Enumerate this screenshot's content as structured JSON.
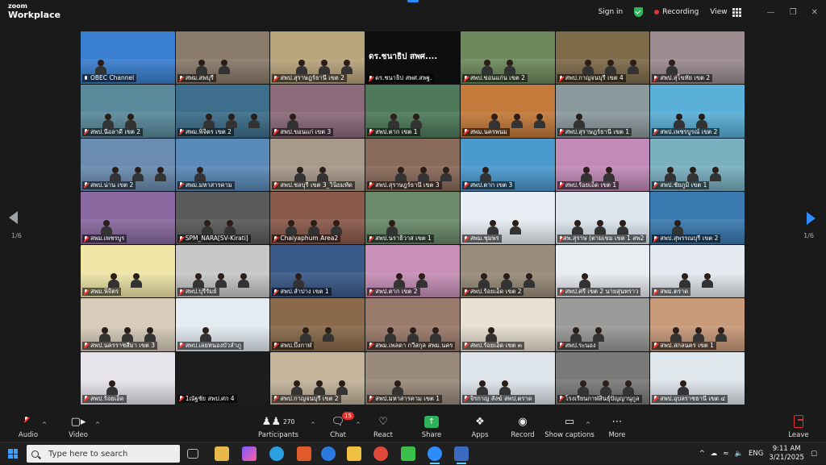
{
  "app": {
    "logo_line1": "zoom",
    "logo_line2": "Workplace"
  },
  "header": {
    "signin": "Sign in",
    "recording": "Recording",
    "view": "View",
    "accent": "#2d8cff",
    "recording_color": "#e0322e",
    "secure_color": "#2fb35a"
  },
  "pagination": {
    "left": "1/6",
    "right": "1/6"
  },
  "tiles": [
    {
      "name": "OBEC Channel",
      "muted": false,
      "bg": "#3a7fd0",
      "active": true
    },
    {
      "name": "สพม.สพบุรี",
      "muted": true,
      "bg": "#8a7a6a"
    },
    {
      "name": "สพป.สุราษฎร์ธานี เขต 2",
      "muted": true,
      "bg": "#b9a57c"
    },
    {
      "name": "ดร.ชนาธิป สพศ.สพฐ.",
      "muted": true,
      "bg": "#0e0e0e",
      "caption": "ดร.ชนาธิป สพศ...."
    },
    {
      "name": "สพป.ขอนแก่น เขต 2",
      "muted": true,
      "bg": "#6e8a5c"
    },
    {
      "name": "สพป.กาญจนบุรี เขต 4",
      "muted": true,
      "bg": "#7e6b4a"
    },
    {
      "name": "สพป.สุโขทัย เขต 2",
      "muted": true,
      "bg": "#9c8c90"
    },
    {
      "name": "สพป.นีอลาดี เขต 2",
      "muted": true,
      "bg": "#5a8a9c"
    },
    {
      "name": "สพม.พิจิตร เขต 2",
      "muted": true,
      "bg": "#3d6e8c"
    },
    {
      "name": "สพป.ขอนแก่ เขต 3",
      "muted": true,
      "bg": "#8c6a7a"
    },
    {
      "name": "สพป.ตาก เขต 1",
      "muted": true,
      "bg": "#4e7a5a"
    },
    {
      "name": "สพม.นครพนม",
      "muted": true,
      "bg": "#c47a3a"
    },
    {
      "name": "สพป.สุราษฎร์ธานี เขต 1",
      "muted": true,
      "bg": "#8c9a9e"
    },
    {
      "name": "สพป.เพชรบูรณ์ เขต 2",
      "muted": true,
      "bg": "#5ab0d8"
    },
    {
      "name": "สพป.น่าน เขต 2",
      "muted": true,
      "bg": "#6a8cb0"
    },
    {
      "name": "สพม.มหาสารคาม",
      "muted": true,
      "bg": "#5a8ab8"
    },
    {
      "name": "สพป.ชลบุรี เขต 3_วินิยมทัด",
      "muted": true,
      "bg": "#a89a8a"
    },
    {
      "name": "สพป.สุราษฎร์ธานี เขต 3",
      "muted": true,
      "bg": "#8a6a5a"
    },
    {
      "name": "สพป.ตาก เขต 3",
      "muted": true,
      "bg": "#4a9ad0"
    },
    {
      "name": "สพป.ร้อยเอ็ด เขต 1",
      "muted": true,
      "bg": "#c28ab8"
    },
    {
      "name": "สพป.ชัยภูมิ เขต 1",
      "muted": true,
      "bg": "#7ab0c0"
    },
    {
      "name": "สพม.เพชรบูร",
      "muted": true,
      "bg": "#8a6aa0"
    },
    {
      "name": "SPM_NARA[SV-Kirati]",
      "muted": true,
      "bg": "#5a5a5a"
    },
    {
      "name": "Chaiyaphum Area2",
      "muted": true,
      "bg": "#8a5a4a"
    },
    {
      "name": "สพป.นราธิวาส เขต 1",
      "muted": true,
      "bg": "#6a8a6a"
    },
    {
      "name": "สพม.ชุมพร",
      "muted": true,
      "bg": "#e8eef4"
    },
    {
      "name": "สพ.สุราษ (ตามเขม เขต 1 สพ2",
      "muted": true,
      "bg": "#dde6ee"
    },
    {
      "name": "สพป.สุพรรณบุรี เขต 2",
      "muted": true,
      "bg": "#3a7ab0"
    },
    {
      "name": "สพม.พิจิตร",
      "muted": true,
      "bg": "#f0e6a8"
    },
    {
      "name": "สพป.บุรีรัมย์",
      "muted": true,
      "bg": "#c8c8c8"
    },
    {
      "name": "สพป.ลำปาง เขต 1",
      "muted": true,
      "bg": "#3a5a8a"
    },
    {
      "name": "สพป.ตาก เขต 2",
      "muted": true,
      "bg": "#c890b8"
    },
    {
      "name": "สพป.ร้อยเอ็ด เขต 2",
      "muted": true,
      "bg": "#9a8c7a"
    },
    {
      "name": "สพป.ศรี เขต 2 นายสุนทราว",
      "muted": true,
      "bg": "#e8edf2"
    },
    {
      "name": "สพม.ตราด",
      "muted": true,
      "bg": "#e4eaf0"
    },
    {
      "name": "สพป.นครราชสีมา เขต 3",
      "muted": true,
      "bg": "#d8ccba"
    },
    {
      "name": "สพป.เลยหนองบัวลำภู",
      "muted": true,
      "bg": "#e4ecf2"
    },
    {
      "name": "สพป.บึงกาฬ",
      "muted": true,
      "bg": "#8a6a4a"
    },
    {
      "name": "สพม.เพลดา กวีสกุล สพม.นคร",
      "muted": true,
      "bg": "#9a7a6a"
    },
    {
      "name": "สพป.ร้อยเอ็ด เขต ๓",
      "muted": true,
      "bg": "#e8e0d0"
    },
    {
      "name": "สพป.ระนอง",
      "muted": true,
      "bg": "#9a9a98"
    },
    {
      "name": "สพป.สกลนคร เขต 1",
      "muted": true,
      "bg": "#c89a7a"
    },
    {
      "name": "สพป.ร้อยเอ็ด",
      "muted": true,
      "bg": "#e8e4ec"
    },
    {
      "name": "1ณัฐชัย สพป.ศก 4",
      "muted": true,
      "bg": "#1c1c1c"
    },
    {
      "name": "สพป.กาญจนบุรี เขต 2",
      "muted": true,
      "bg": "#c4b49a"
    },
    {
      "name": "สพป.มหาสารคาม เขต 1",
      "muted": true,
      "bg": "#9a8a7a"
    },
    {
      "name": "จิรกาญ สังฆ์ สพป.ตราด",
      "muted": true,
      "bg": "#dde4ea"
    },
    {
      "name": "โรงเรียนกาฬสินธุ์ปัญญานุกูล",
      "muted": true,
      "bg": "#7a7a78"
    },
    {
      "name": "สพป.อุบลราชธานี เขต ๔",
      "muted": true,
      "bg": "#dfe6ec"
    }
  ],
  "toolbar": {
    "audio": "Audio",
    "video": "Video",
    "participants": "Participants",
    "participants_count": "270",
    "chat": "Chat",
    "chat_badge": "15",
    "react": "React",
    "share": "Share",
    "apps": "Apps",
    "record": "Record",
    "captions": "Show captions",
    "more": "More",
    "leave": "Leave"
  },
  "taskbar": {
    "search_placeholder": "Type here to search",
    "lang": "ENG",
    "time": "9:11 AM",
    "date": "3/21/2025"
  }
}
